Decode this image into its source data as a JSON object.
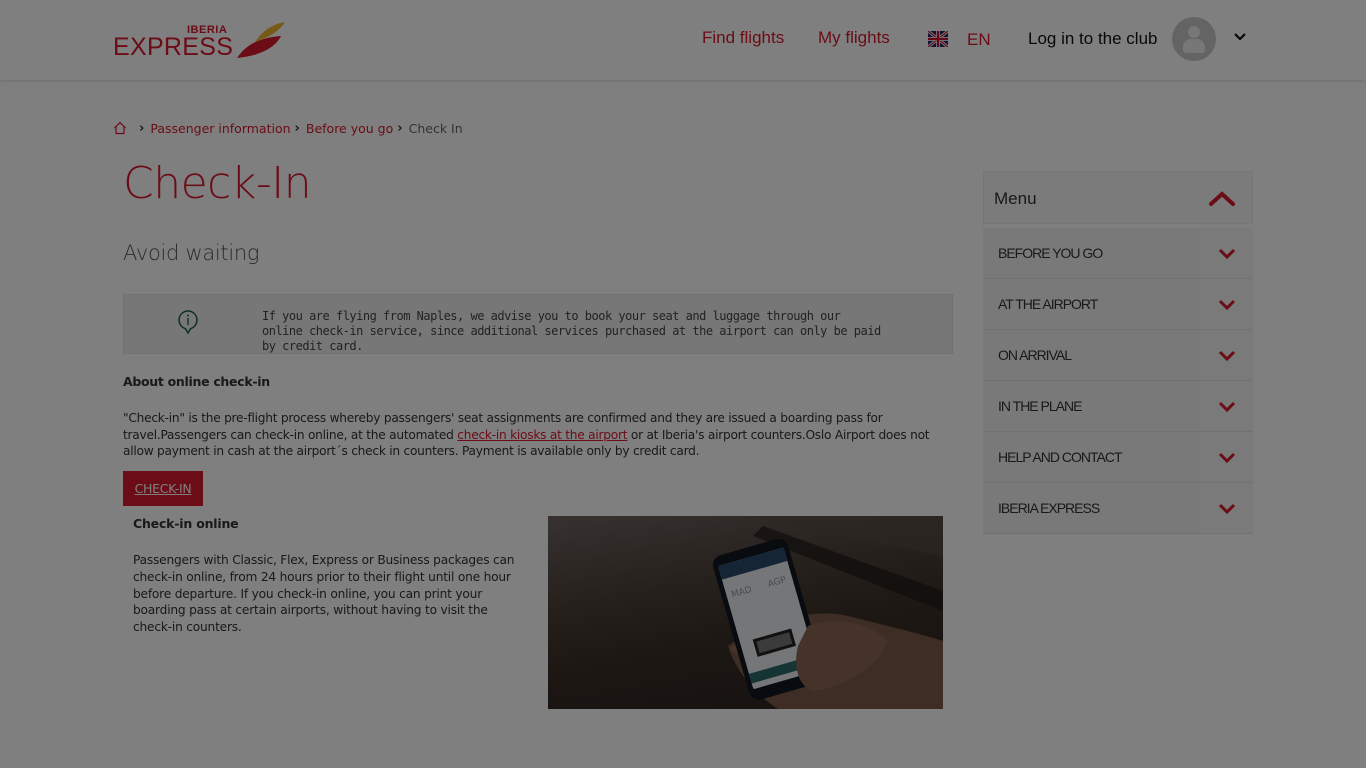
{
  "header": {
    "logo": {
      "small": "IBERIA",
      "large": "EXPRESS"
    },
    "nav": {
      "find_flights": "Find flights",
      "my_flights": "My flights",
      "language": "EN",
      "flag_icon": "uk-flag-icon",
      "login": "Log in to the club"
    }
  },
  "breadcrumb": {
    "items": [
      "Passenger information",
      "Before you go"
    ],
    "current": "Check In"
  },
  "main": {
    "title": "Check-In",
    "subtitle": "Avoid waiting",
    "notice": "If you are flying from Naples, we advise you to book your seat and luggage through our online check-in service, since additional services purchased at the airport can only be paid by credit card.",
    "about_title": "About online check-in",
    "about_text_1": "\"Check-in\" is the pre-flight process whereby passengers' seat assignments are confirmed and they are issued a boarding pass for travel.Passengers can check-in online, at the automated ",
    "about_link": "check-in kiosks at the airport",
    "about_text_2": " or at Iberia's airport counters.Oslo Airport does not allow payment in cash at the airport´s check in counters. Payment is available only by credit card.",
    "checkin_button": "CHECK-IN",
    "online_title": "Check-in online",
    "online_text": "Passengers with Classic, Flex, Express or Business packages can check-in online, from 24 hours prior to their flight until one hour before departure. If you check-in online, you can print your boarding pass at certain airports, without having to visit the check-in counters.",
    "photo_phone": {
      "from": "MAD",
      "to": "AGP"
    }
  },
  "sidemenu": {
    "title": "Menu",
    "items": [
      {
        "label": "BEFORE YOU GO"
      },
      {
        "label": "AT THE AIRPORT"
      },
      {
        "label": "ON ARRIVAL"
      },
      {
        "label": "IN THE PLANE"
      },
      {
        "label": "HELP AND CONTACT"
      },
      {
        "label": "IBERIA EXPRESS"
      }
    ]
  },
  "colors": {
    "brand_red": "#d7192d",
    "brand_yellow": "#f1b52f",
    "overlay": "rgba(0,0,0,0.5)"
  }
}
